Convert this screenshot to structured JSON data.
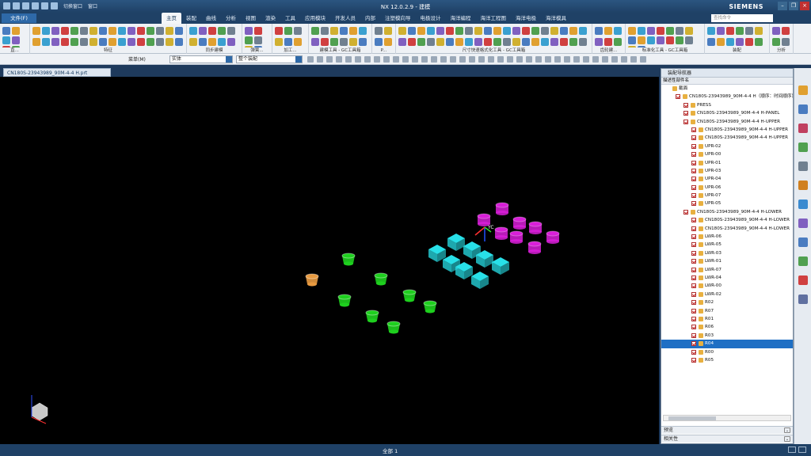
{
  "app": {
    "title": "NX 12.0.2.9 - 建模",
    "brand": "SIEMENS",
    "window_menu": "切换窗口",
    "window_menu2": "窗口"
  },
  "ribbon": {
    "file_tab": "文件(F)",
    "tabs": [
      "主页",
      "装配",
      "曲线",
      "分析",
      "视图",
      "渲染",
      "工具",
      "应用模块",
      "开发人员",
      "内部",
      "注塑模向导",
      "电极设计",
      "海洋编程",
      "海洋工程图",
      "海洋电极",
      "海洋模具"
    ],
    "active_tab": "主页",
    "search_placeholder": "查找命令",
    "groups": [
      "直...",
      "特征",
      "同步建模",
      "弹簧...",
      "加工...",
      "建模工具 - GC工具箱",
      "P...",
      "尺寸快速格式化工具 - GC工具箱",
      "齿轮建...",
      "标准化工具 - GC工具箱",
      "装配",
      "分析"
    ]
  },
  "toolbar2": {
    "menu_label": "菜单(M)",
    "filter_value": "实体",
    "scope_value": "整个装配"
  },
  "document_tab": "CN180S-23943989_90M-4-4 H.prt",
  "navigator": {
    "title": "装配导航器",
    "column_header": "描述性部件名",
    "rows": [
      {
        "label": "截面",
        "level": 0,
        "check": false
      },
      {
        "label": "CN180S-23943989_90M-4-4 H（顺序：时间顺序）",
        "level": 0,
        "check": true
      },
      {
        "label": "PRESS",
        "level": 1,
        "check": true
      },
      {
        "label": "CN180S-23943989_90M-4-4 H-PANEL",
        "level": 1,
        "check": true
      },
      {
        "label": "CN180S-23943989_90M-4-4 H-UPPER",
        "level": 1,
        "check": true
      },
      {
        "label": "CN180S-23943989_90M-4-4 H-UPPER",
        "level": 2,
        "check": true
      },
      {
        "label": "CN180S-23943989_90M-4-4 H-UPPER",
        "level": 2,
        "check": true
      },
      {
        "label": "UPR-02",
        "level": 2,
        "check": true
      },
      {
        "label": "UPR-00",
        "level": 2,
        "check": true
      },
      {
        "label": "UPR-01",
        "level": 2,
        "check": true
      },
      {
        "label": "UPR-03",
        "level": 2,
        "check": true
      },
      {
        "label": "UPR-04",
        "level": 2,
        "check": true
      },
      {
        "label": "UPR-06",
        "level": 2,
        "check": true
      },
      {
        "label": "UPR-07",
        "level": 2,
        "check": true
      },
      {
        "label": "UPR-05",
        "level": 2,
        "check": true
      },
      {
        "label": "CN180S-23943989_90M-4-4 H-LOWER",
        "level": 1,
        "check": true
      },
      {
        "label": "CN180S-23943989_90M-4-4 H-LOWER",
        "level": 2,
        "check": true
      },
      {
        "label": "CN180S-23943989_90M-4-4 H-LOWER",
        "level": 2,
        "check": true
      },
      {
        "label": "LWR-06",
        "level": 2,
        "check": true
      },
      {
        "label": "LWR-05",
        "level": 2,
        "check": true
      },
      {
        "label": "LWR-03",
        "level": 2,
        "check": true
      },
      {
        "label": "LWR-01",
        "level": 2,
        "check": true
      },
      {
        "label": "LWR-07",
        "level": 2,
        "check": true
      },
      {
        "label": "LWR-04",
        "level": 2,
        "check": true
      },
      {
        "label": "LWR-00",
        "level": 2,
        "check": true
      },
      {
        "label": "LWR-02",
        "level": 2,
        "check": true
      },
      {
        "label": "R02",
        "level": 2,
        "check": true
      },
      {
        "label": "R07",
        "level": 2,
        "check": true
      },
      {
        "label": "R01",
        "level": 2,
        "check": true
      },
      {
        "label": "R06",
        "level": 2,
        "check": true
      },
      {
        "label": "R03",
        "level": 2,
        "check": true
      },
      {
        "label": "R04",
        "level": 2,
        "check": true,
        "selected": true
      },
      {
        "label": "R00",
        "level": 2,
        "check": true
      },
      {
        "label": "R05",
        "level": 2,
        "check": true
      }
    ],
    "preview_label": "预览",
    "dependency_label": "相关性"
  },
  "viewport": {
    "csys_label": "YC",
    "colors": {
      "magenta": "#d81fd8",
      "cyan": "#28e0e8",
      "green": "#1ed01e",
      "orange": "#e89a40"
    }
  },
  "status": {
    "filter": "全部 1"
  }
}
